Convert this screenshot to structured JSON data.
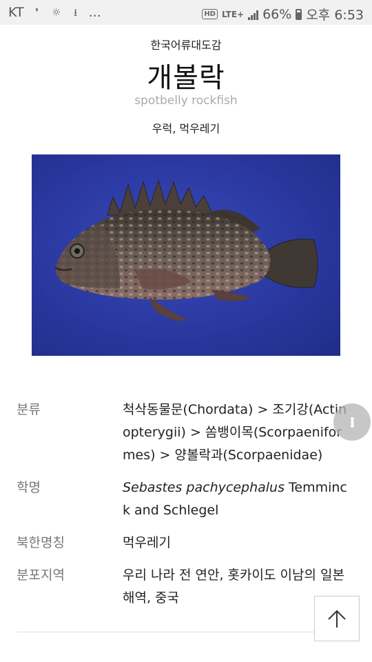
{
  "status_bar": {
    "carrier": "KT",
    "ellipsis": "...",
    "hd": "HD",
    "lte": "LTE+",
    "battery": "66%",
    "time": "오후 6:53"
  },
  "header": {
    "book_title": "한국어류대도감",
    "fish_name": "개볼락",
    "english_name": "spotbelly rockfish",
    "aliases": "우럭, 먹우레기"
  },
  "image": {
    "icon": "fish-photo",
    "background_color": "#2a38a0"
  },
  "info": {
    "classification": {
      "label": "분류",
      "value": "척삭동물문(Chordata) > 조기강(Actinopterygii) > 쏨뱅이목(Scorpaeniformes) > 양볼락과(Scorpaenidae)"
    },
    "scientific_name": {
      "label": "학명",
      "genus_species": "Sebastes pachycephalus",
      "author": " Temminck and Schlegel"
    },
    "north_korean_name": {
      "label": "북한명칭",
      "value": "먹우레기"
    },
    "distribution": {
      "label": "분포지역",
      "value": "우리 나라 전 연안, 홋카이도 이남의 일본 해역, 중국"
    }
  },
  "controls": {
    "more_icon": "more-vertical-icon",
    "top_icon": "arrow-up-icon"
  }
}
